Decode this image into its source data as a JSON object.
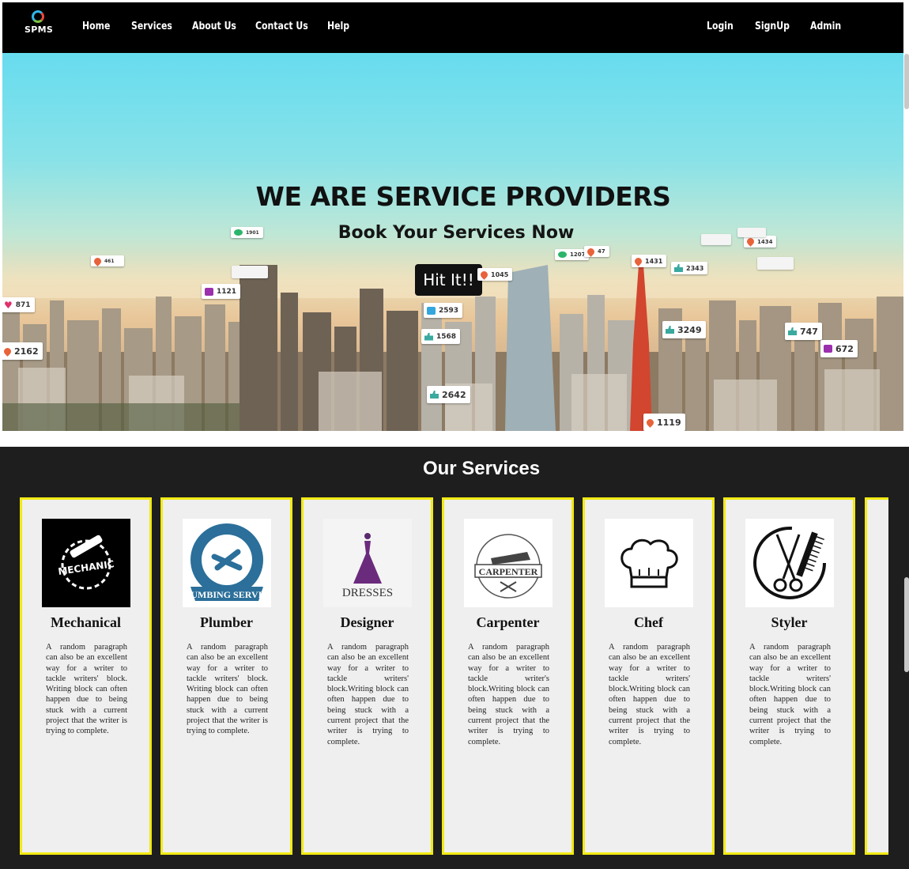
{
  "navbar": {
    "logo_text": "SPMS",
    "links": [
      "Home",
      "Services",
      "About Us",
      "Contact Us",
      "Help"
    ],
    "right_links": [
      "Login",
      "SignUp",
      "Admin"
    ]
  },
  "hero": {
    "title": "WE ARE SERVICE PROVIDERS",
    "subtitle": "Book Your Services Now",
    "button_label": "Hit It!!",
    "badges": [
      {
        "icon": "heart-icon",
        "value": "871"
      },
      {
        "icon": "location-pin-icon",
        "value": "2162"
      },
      {
        "icon": "instagram-icon",
        "value": "1121"
      },
      {
        "icon": "chat-icon",
        "value": "1901"
      },
      {
        "icon": "location-pin-icon",
        "value": "461"
      },
      {
        "icon": "mail-icon",
        "value": "2593"
      },
      {
        "icon": "thumbs-up-icon",
        "value": "1568"
      },
      {
        "icon": "thumbs-up-icon",
        "value": "2642"
      },
      {
        "icon": "location-pin-icon",
        "value": "1045"
      },
      {
        "icon": "chat-icon",
        "value": "1207"
      },
      {
        "icon": "location-pin-icon",
        "value": "47"
      },
      {
        "icon": "location-pin-icon",
        "value": "1431"
      },
      {
        "icon": "thumbs-up-icon",
        "value": "2343"
      },
      {
        "icon": "location-pin-icon",
        "value": "1434"
      },
      {
        "icon": "thumbs-up-icon",
        "value": "3249"
      },
      {
        "icon": "thumbs-up-icon",
        "value": "747"
      },
      {
        "icon": "instagram-icon",
        "value": "672"
      },
      {
        "icon": "location-pin-icon",
        "value": "1119"
      }
    ]
  },
  "services": {
    "title": "Our Services",
    "cards": [
      {
        "name": "Mechanical",
        "image_text": "MECHANIC",
        "description": "A random paragraph can also be an excellent way for a writer to tackle writers' block. Writing block can often happen due to being stuck with a current project that the writer is trying to complete."
      },
      {
        "name": "Plumber",
        "image_text": "PLUMBING SERVICE",
        "description": "A random paragraph can also be an excellent way for a writer to tackle writers' block. Writing block can often happen due to being stuck with a current project that the writer is trying to complete."
      },
      {
        "name": "Designer",
        "image_text": "DRESSES",
        "description": "A random paragraph can also be an excellent way for a writer to tackle writers' block.Writing block can often happen due to being stuck with a current project that the writer is trying to complete."
      },
      {
        "name": "Carpenter",
        "image_text": "CARPENTER",
        "description": "A random paragraph can also be an excellent way for a writer to tackle writer's block.Writing block can often happen due to being stuck with a current project that the writer is trying to complete."
      },
      {
        "name": "Chef",
        "image_text": "",
        "description": "A random paragraph can also be an excellent way for a writer to tackle writers' block.Writing block can often happen due to being stuck with a current project that the writer is trying to complete."
      },
      {
        "name": "Styler",
        "image_text": "",
        "description": "A random paragraph can also be an excellent way for a writer to tackle writers' block.Writing block can often happen due to being stuck with a current project that the writer is trying to complete."
      }
    ]
  },
  "colors": {
    "navbar_bg": "#000000",
    "card_border": "#f2ea12",
    "services_bg": "#1e1e1e"
  }
}
